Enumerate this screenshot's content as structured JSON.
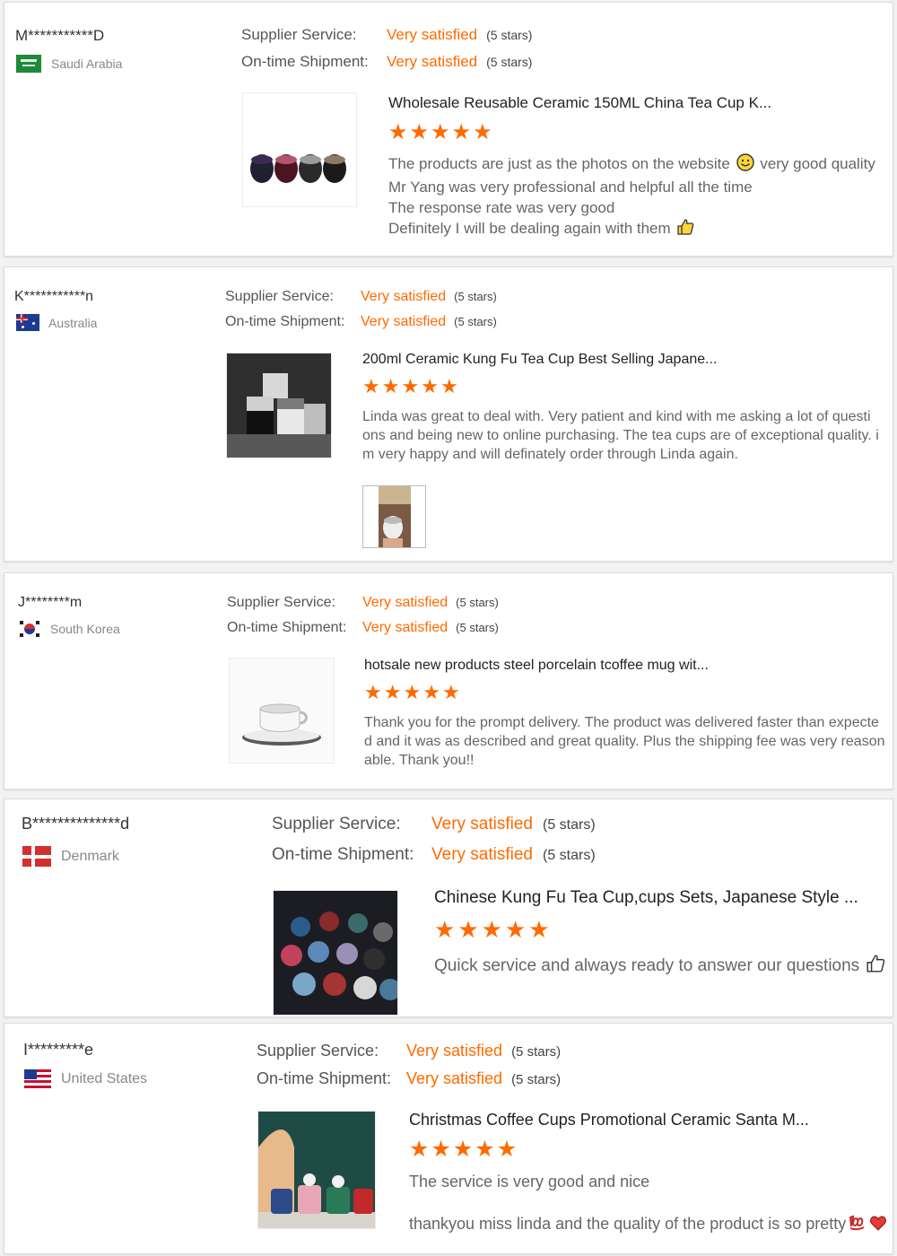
{
  "colors": {
    "accent": "#ff6a00",
    "label": "#555555",
    "muted": "#888888",
    "title": "#222222"
  },
  "reviews": [
    {
      "buyer": "M***********D",
      "country": "Saudi Arabia",
      "flag_icon": "saudi-arabia-flag-icon",
      "supplier_label": "Supplier Service:",
      "supplier_value": "Very satisfied",
      "supplier_stars": "(5 stars)",
      "shipment_label": "On-time Shipment:",
      "shipment_value": "Very satisfied",
      "shipment_stars": "(5 stars)",
      "product_title": "Wholesale Reusable Ceramic 150ML China Tea Cup K...",
      "rating": 5,
      "text_lines": [
        "The products are just as the photos on the website",
        "Mr Yang was very professional and helpful all the time",
        "The response rate was very good",
        "Definitely I will be dealing again with them"
      ],
      "text_line1_tail": "very good quality"
    },
    {
      "buyer": "K***********n",
      "country": "Australia",
      "flag_icon": "australia-flag-icon",
      "supplier_label": "Supplier Service:",
      "supplier_value": "Very satisfied",
      "supplier_stars": "(5 stars)",
      "shipment_label": "On-time Shipment:",
      "shipment_value": "Very satisfied",
      "shipment_stars": "(5 stars)",
      "product_title": "200ml Ceramic Kung Fu Tea Cup Best Selling Japane...",
      "rating": 5,
      "text_lines": [
        "Linda was great to deal with.  Very patient and kind with me asking a lot of questi",
        "ons and being new to online purchasing. The tea cups are of exceptional quality. i",
        "m very happy and will definately order through Linda again."
      ]
    },
    {
      "buyer": "J********m",
      "country": "South Korea",
      "flag_icon": "south-korea-flag-icon",
      "supplier_label": "Supplier Service:",
      "supplier_value": "Very satisfied",
      "supplier_stars": "(5 stars)",
      "shipment_label": "On-time Shipment:",
      "shipment_value": "Very satisfied",
      "shipment_stars": "(5 stars)",
      "product_title": "hotsale new products steel porcelain tcoffee mug wit...",
      "rating": 5,
      "text_lines": [
        "Thank you for the prompt delivery. The product was delivered faster than expecte",
        "d and it was as described and great quality. Plus the shipping fee was very reason",
        "able. Thank you!!"
      ]
    },
    {
      "buyer": "B**************d",
      "country": "Denmark",
      "flag_icon": "denmark-flag-icon",
      "supplier_label": "Supplier Service:",
      "supplier_value": "Very satisfied",
      "supplier_stars": "(5 stars)",
      "shipment_label": "On-time Shipment:",
      "shipment_value": "Very satisfied",
      "shipment_stars": "(5 stars)",
      "product_title": "Chinese Kung Fu Tea Cup,cups Sets, Japanese Style ...",
      "rating": 5,
      "text_lines": [
        "Quick service and always ready to answer our questions"
      ]
    },
    {
      "buyer": "I*********e",
      "country": "United States",
      "flag_icon": "united-states-flag-icon",
      "supplier_label": "Supplier Service:",
      "supplier_value": "Very satisfied",
      "supplier_stars": "(5 stars)",
      "shipment_label": "On-time Shipment:",
      "shipment_value": "Very satisfied",
      "shipment_stars": "(5 stars)",
      "product_title": "Christmas Coffee Cups Promotional Ceramic Santa M...",
      "rating": 5,
      "text_lines": [
        "The service is very good and nice",
        "thankyou miss linda and the quality of the product is so pretty"
      ]
    }
  ]
}
